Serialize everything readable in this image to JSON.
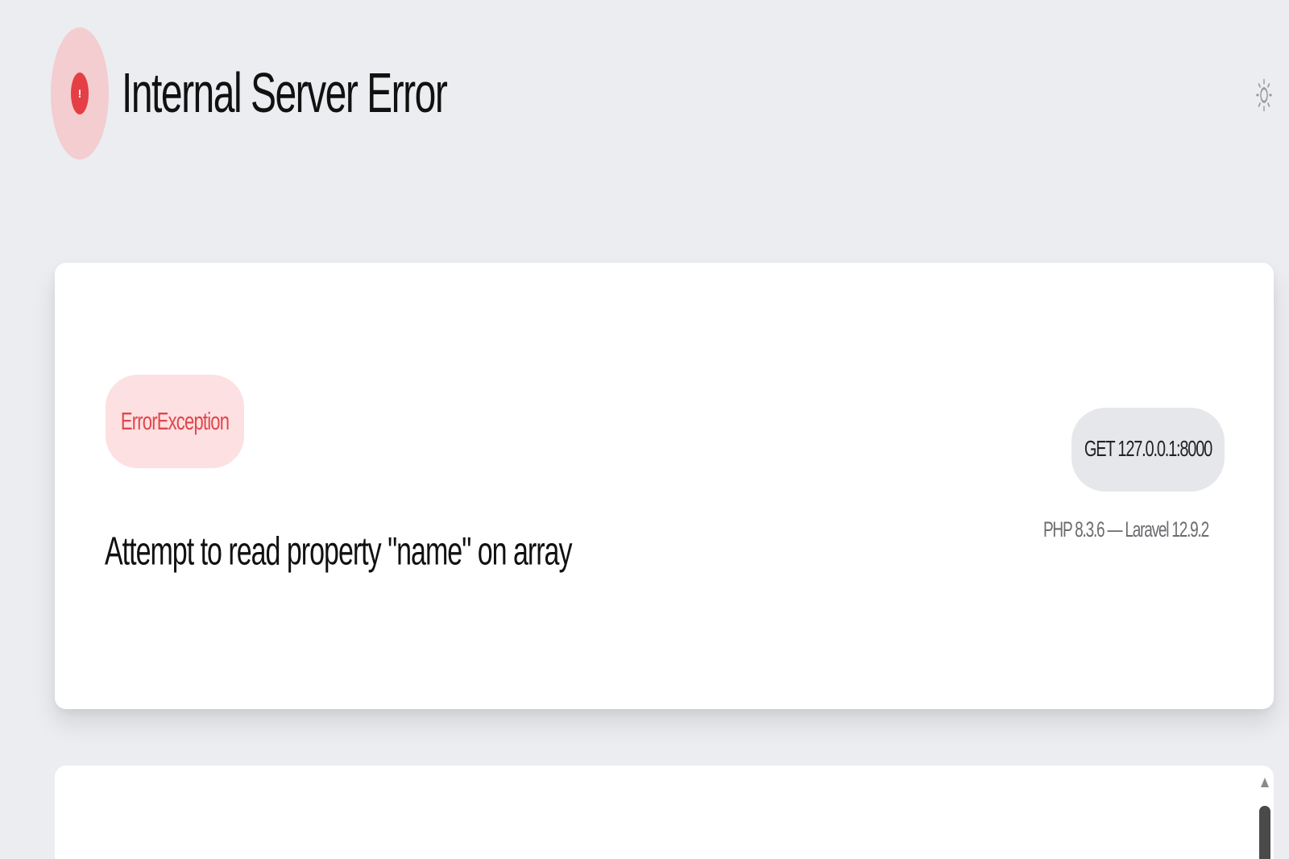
{
  "header": {
    "title": "Internal Server Error",
    "status_icon": "exclamation-icon",
    "status_icon_glyph": "!",
    "theme_icon": "sun-icon"
  },
  "error": {
    "exception_class": "ErrorException",
    "message": "Attempt to read property \"name\" on array",
    "request": "GET 127.0.0.1:8000",
    "versions": "PHP 8.3.6 — Laravel 12.9.2"
  },
  "colors": {
    "background": "#ebedf0",
    "accent_red": "#e53e45",
    "badge_red_bg": "#fde0e1",
    "pill_bg": "#e6e7ea"
  }
}
